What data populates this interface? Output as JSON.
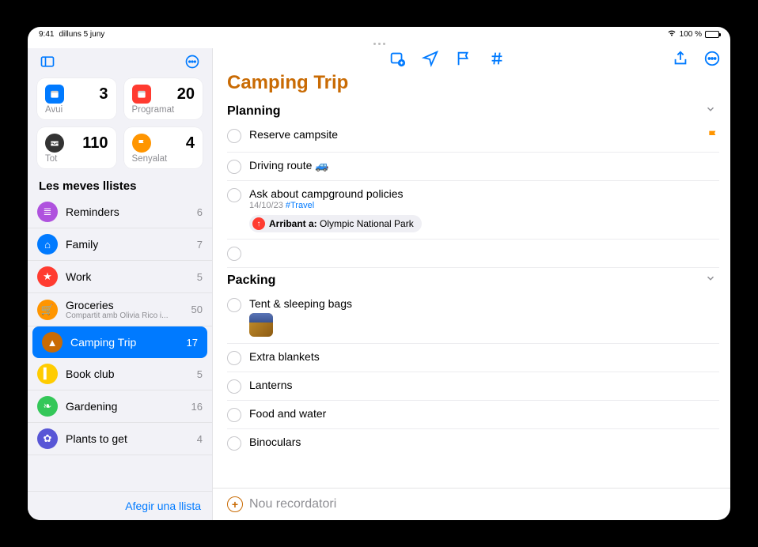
{
  "status": {
    "time": "9:41",
    "date": "dilluns 5 juny",
    "battery": "100 %"
  },
  "sidebar": {
    "smart": [
      {
        "label": "Avui",
        "count": 3,
        "color": "#007aff",
        "shape": "square",
        "glyph": "calendar"
      },
      {
        "label": "Programat",
        "count": 20,
        "color": "#ff3b30",
        "shape": "square",
        "glyph": "calendar"
      },
      {
        "label": "Tot",
        "count": 110,
        "color": "#333",
        "shape": "round",
        "glyph": "tray"
      },
      {
        "label": "Senyalat",
        "count": 4,
        "color": "#ff9500",
        "shape": "round",
        "glyph": "flag"
      }
    ],
    "header": "Les meves llistes",
    "lists": [
      {
        "name": "Reminders",
        "count": 6,
        "color": "#af52de",
        "glyph": "≣"
      },
      {
        "name": "Family",
        "count": 7,
        "color": "#007aff",
        "glyph": "⌂"
      },
      {
        "name": "Work",
        "count": 5,
        "color": "#ff3b30",
        "glyph": "★"
      },
      {
        "name": "Groceries",
        "count": 50,
        "color": "#ff9500",
        "glyph": "🛒",
        "sub": "Compartit amb Olivia Rico i..."
      },
      {
        "name": "Camping Trip",
        "count": 17,
        "color": "#c96b04",
        "glyph": "▲",
        "selected": true
      },
      {
        "name": "Book club",
        "count": 5,
        "color": "#ffcc00",
        "glyph": "▍"
      },
      {
        "name": "Gardening",
        "count": 16,
        "color": "#34c759",
        "glyph": "❧"
      },
      {
        "name": "Plants to get",
        "count": 4,
        "color": "#5856d6",
        "glyph": "✿"
      }
    ],
    "footer": "Afegir una llista"
  },
  "main": {
    "title": "Camping Trip",
    "sections": [
      {
        "title": "Planning",
        "items": [
          {
            "title": "Reserve campsite",
            "flagged": true
          },
          {
            "title": "Driving route 🚙"
          },
          {
            "title": "Ask about campground policies",
            "date": "14/10/23",
            "tag": "#Travel",
            "location_prefix": "Arribant a:",
            "location": "Olympic National Park"
          },
          {
            "title": ""
          }
        ]
      },
      {
        "title": "Packing",
        "items": [
          {
            "title": "Tent & sleeping bags",
            "thumb": true
          },
          {
            "title": "Extra blankets"
          },
          {
            "title": "Lanterns"
          },
          {
            "title": "Food and water"
          },
          {
            "title": "Binoculars"
          }
        ]
      }
    ],
    "new_label": "Nou recordatori"
  }
}
